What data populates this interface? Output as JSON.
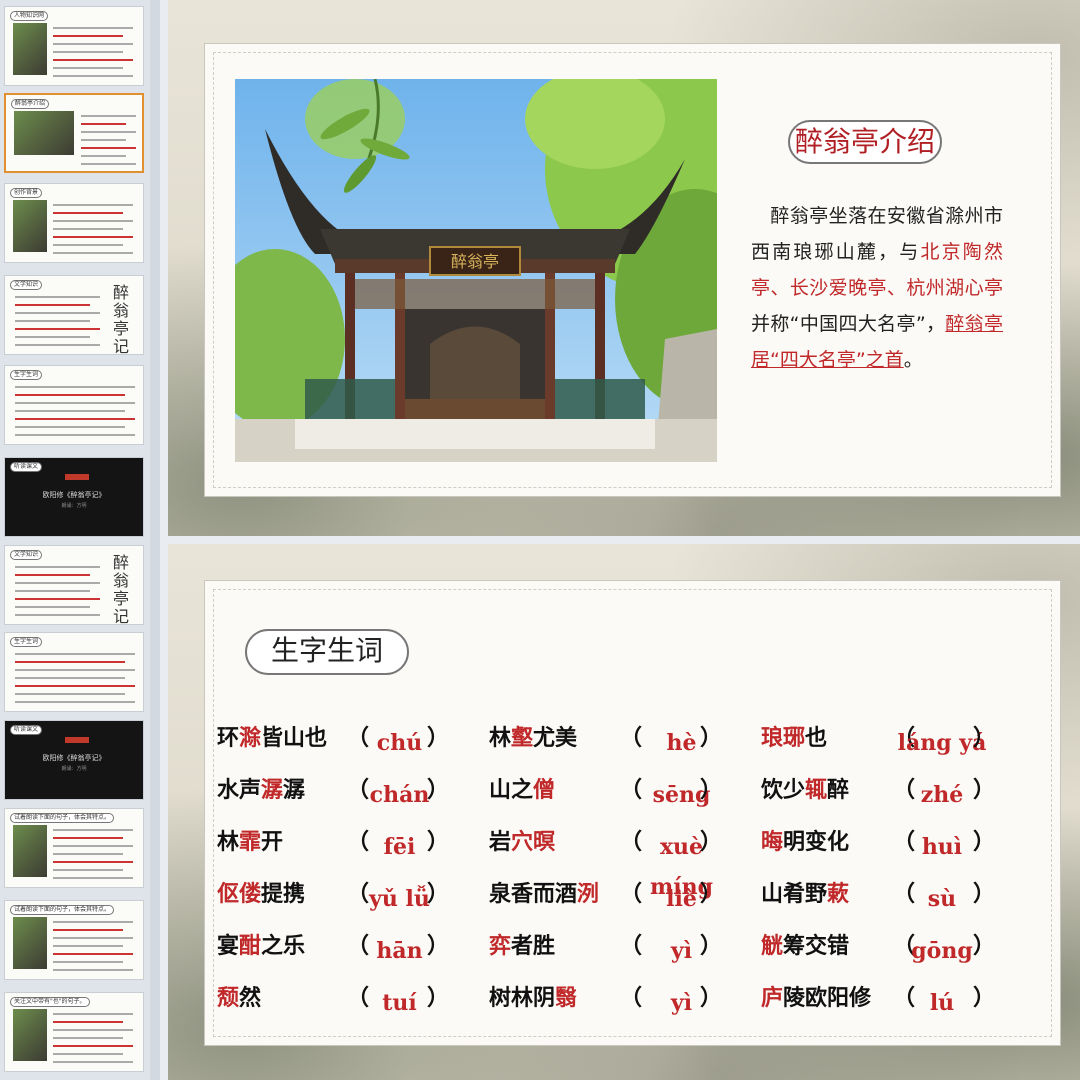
{
  "rail": {
    "thumbs": [
      {
        "tag": "人物知识网"
      },
      {
        "tag": "醉翁亭介绍"
      },
      {
        "tag": "创作背景"
      },
      {
        "tag": "文学知识",
        "callig": "醉翁亭记"
      },
      {
        "tag": "生字生词"
      },
      {
        "tag": "听读课文",
        "video_title": "欧阳修《醉翁亭记》",
        "video_sub": "朗诵：方明"
      },
      {
        "tag": "文学知识",
        "callig": "醉翁亭记"
      },
      {
        "tag": "生字生词"
      },
      {
        "tag": "听读课文",
        "video_title": "欧阳修《醉翁亭记》",
        "video_sub": "朗诵：方明"
      },
      {
        "tag": "试着朗读下面的句子，体会其特点。"
      },
      {
        "tag": "试着朗读下面的句子，体会其特点。"
      },
      {
        "tag": "关注文中带有\"也\"的句子。"
      }
    ]
  },
  "slide1": {
    "title": "醉翁亭介绍",
    "plaque": "醉翁亭",
    "intro": {
      "p1": "醉翁亭坐落在安徽省滁州市西南琅琊山麓，与",
      "p2_red": "北京陶然亭、长沙爱晚亭、杭州湖心亭",
      "p3": "并称“中国四大名亭”，",
      "p4_u": "醉翁亭居“四大名亭”之首",
      "p5": "。"
    }
  },
  "slide2": {
    "title": "生字生词",
    "rows": [
      [
        {
          "pre": "环",
          "key": "滁",
          "post": "皆山也",
          "py": "chú"
        },
        {
          "pre": "林",
          "key": "壑",
          "post": "尤美",
          "py": "hè"
        },
        {
          "pre": "",
          "key": "琅琊",
          "post": "也",
          "py": "láng yá"
        }
      ],
      [
        {
          "pre": "水声",
          "key": "潺",
          "post": "潺",
          "py": "chán"
        },
        {
          "pre": "山之",
          "key": "僧",
          "post": "",
          "py": "sēng"
        },
        {
          "pre": "饮少",
          "key": "辄",
          "post": "醉",
          "py": "zhé"
        }
      ],
      [
        {
          "pre": "林",
          "key": "霏",
          "post": "开",
          "py": "fēi"
        },
        {
          "pre": "岩",
          "key": "穴暝",
          "post": "",
          "py": "xuè míng"
        },
        {
          "pre": "",
          "key": "晦",
          "post": "明变化",
          "py": "huì"
        }
      ],
      [
        {
          "pre": "",
          "key": "伛偻",
          "post": "提携",
          "py": "yǔ lǚ"
        },
        {
          "pre": "泉香而酒",
          "key": "洌",
          "post": "",
          "py": "liè"
        },
        {
          "pre": "山肴野",
          "key": "蔌",
          "post": "",
          "py": "sù"
        }
      ],
      [
        {
          "pre": "宴",
          "key": "酣",
          "post": "之乐",
          "py": "hān"
        },
        {
          "pre": "",
          "key": "弈",
          "post": "者胜",
          "py": "yì"
        },
        {
          "pre": "",
          "key": "觥",
          "post": "筹交错",
          "py": "gōng"
        }
      ],
      [
        {
          "pre": "",
          "key": "颓",
          "post": "然",
          "py": "tuí"
        },
        {
          "pre": "树林阴",
          "key": "翳",
          "post": "",
          "py": "yì"
        },
        {
          "pre": "",
          "key": "庐",
          "post": "陵欧阳修",
          "py": "lú"
        }
      ]
    ]
  },
  "colors": {
    "accent_red": "#c0282a",
    "active_thumb": "#e0902f"
  }
}
